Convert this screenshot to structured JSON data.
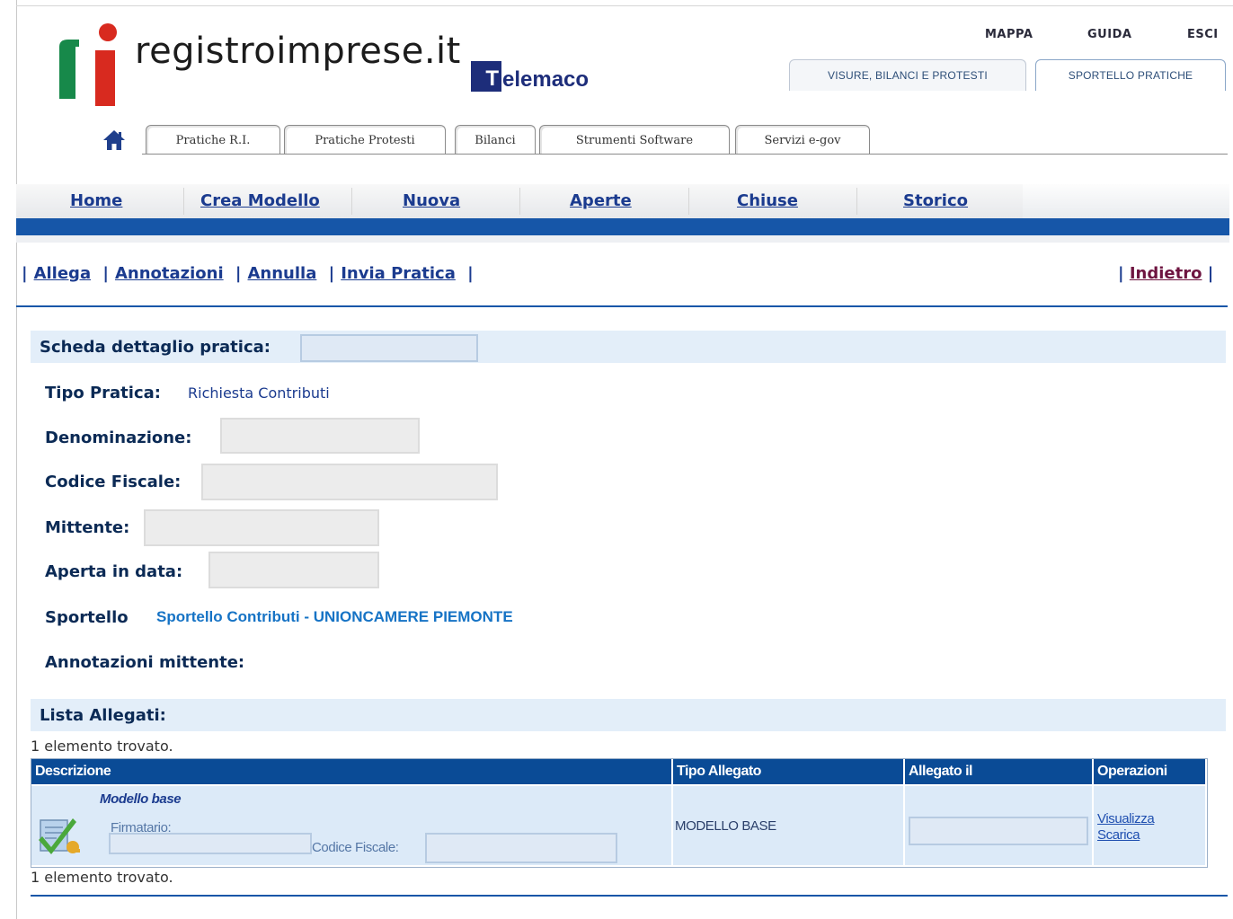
{
  "brand": {
    "name": "registroimprese.it",
    "telemaco_letter": "T",
    "telemaco_rest": "elemaco"
  },
  "top_links": [
    "MAPPA",
    "GUIDA",
    "ESCI"
  ],
  "top_tabs": [
    "VISURE, BILANCI E PROTESTI",
    "SPORTELLO PRATICHE"
  ],
  "section_tabs": [
    "Pratiche R.I.",
    "Pratiche Protesti",
    "Bilanci",
    "Strumenti Software",
    "Servizi e-gov"
  ],
  "menu": [
    "Home",
    "Crea Modello",
    "Nuova",
    "Aperte",
    "Chiuse",
    "Storico"
  ],
  "actions": [
    "Allega",
    "Annotazioni",
    "Annulla",
    "Invia Pratica"
  ],
  "back_label": "Indietro",
  "scheda": {
    "title": "Scheda dettaglio pratica:",
    "tipo_label": "Tipo Pratica:",
    "tipo_value": "Richiesta Contributi",
    "denominazione_label": "Denominazione:",
    "codice_fiscale_label": "Codice Fiscale:",
    "mittente_label": "Mittente:",
    "aperta_label": "Aperta in data:",
    "sportello_label": "Sportello",
    "sportello_value": "Sportello Contributi  - UNIONCAMERE PIEMONTE",
    "annotazioni_label": "Annotazioni mittente:"
  },
  "allegati": {
    "title": "Lista Allegati:",
    "count_text": "1 elemento trovato.",
    "columns": [
      "Descrizione",
      "Tipo Allegato",
      "Allegato il",
      "Operazioni"
    ],
    "row": {
      "descrizione": "Modello base",
      "firmatario_label": "Firmatario:",
      "codice_fiscale_label": "Codice Fiscale:",
      "tipo": "MODELLO BASE",
      "op_view": "Visualizza",
      "op_download": "Scarica"
    }
  },
  "colors": {
    "accent_blue": "#1656a8",
    "header_blue": "#0a4b96",
    "link_blue": "#1b3b8f",
    "sportello_blue": "#1673c5"
  }
}
